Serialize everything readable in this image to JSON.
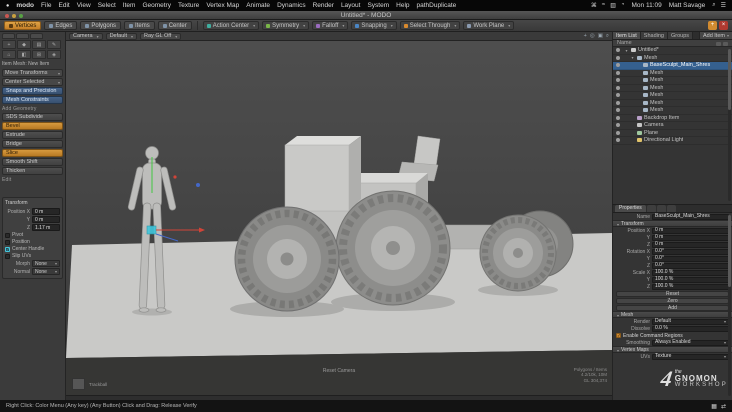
{
  "titlebar": {
    "title": "Untitled* - MODO"
  },
  "menu_bar": {
    "apple_icon": "●",
    "items": [
      "modo",
      "File",
      "Edit",
      "View",
      "Select",
      "Item",
      "Geometry",
      "Texture",
      "Vertex Map",
      "Animate",
      "Dynamics",
      "Render",
      "Layout",
      "System",
      "Help",
      "pathDuplicate"
    ],
    "status_icons": [
      "⌘",
      "≈",
      "▥",
      "◔"
    ],
    "clock": "Mon 11:09",
    "user": "Matt Savage",
    "spotlight_icon": "⌕",
    "notification_icon": "☰"
  },
  "toolbar": {
    "modes": [
      {
        "label": "Vertices",
        "active": true
      },
      {
        "label": "Edges"
      },
      {
        "label": "Polygons"
      },
      {
        "label": "Items"
      },
      {
        "label": "Center"
      }
    ],
    "tools": [
      {
        "label": "Action Center",
        "color": "#3fae9f"
      },
      {
        "label": "Symmetry",
        "color": "#7ab648"
      },
      {
        "label": "Falloff",
        "color": "#9a6bbf"
      },
      {
        "label": "Snapping",
        "color": "#4a86c5"
      },
      {
        "label": "Select Through",
        "color": "#d98a2e"
      },
      {
        "label": "Work Plane",
        "color": "#8a9ab0"
      }
    ],
    "add_button": "+",
    "close_button": "×"
  },
  "sidebar": {
    "palette_icons": [
      "+",
      "◆",
      "▤",
      "✎",
      "⌂",
      "◧",
      "⊞",
      "◈"
    ],
    "caption": "Item Mesh: New Item",
    "dropdowns": [
      {
        "label": "Move Transforms"
      },
      {
        "label": "Center Selected"
      }
    ],
    "palette_buttons": [
      {
        "label": "Snaps and Precision"
      },
      {
        "label": "Mesh Constraints"
      }
    ],
    "add_geometry_label": "Add Geometry",
    "tools": [
      {
        "label": "SDS Subdivide"
      },
      {
        "label": "Bevel",
        "accent": true
      },
      {
        "label": "Extrude"
      },
      {
        "label": "Bridge"
      },
      {
        "label": "Slice",
        "accent": true
      },
      {
        "label": "Smooth Shift"
      },
      {
        "label": "Thicken"
      }
    ],
    "edit_label": "Edit",
    "transform_panel": {
      "title": "Transform",
      "fields": [
        {
          "label": "Position X",
          "value": "0 m"
        },
        {
          "label": "Y",
          "value": "0 m"
        },
        {
          "label": "Z",
          "value": "1.17 m"
        }
      ],
      "toggles": [
        {
          "label": "Pivot",
          "checked": false
        },
        {
          "label": "Position",
          "checked": false
        },
        {
          "label": "Center Handle",
          "checked": true
        },
        {
          "label": "Slip UVs",
          "checked": false
        }
      ],
      "selects": [
        {
          "label": "Morph",
          "value": "None"
        },
        {
          "label": "Normal",
          "value": "None"
        }
      ]
    }
  },
  "viewport": {
    "header": {
      "camera_menu": "Camera",
      "view_menu": "Default",
      "raygl_menu": "Ray GL Off",
      "icons": [
        "+",
        "◎",
        "▣",
        "⌕"
      ]
    },
    "overlay": {
      "reset_camera": "Reset Camera",
      "trackball": "Trackball",
      "stats": [
        "Polygons / Items",
        "4.2/10k, 10M",
        "GL 304,374"
      ]
    }
  },
  "item_list": {
    "tabs": [
      {
        "label": "Item List"
      },
      {
        "label": "Shading"
      },
      {
        "label": "Groups"
      }
    ],
    "add_item_button": "Add Item",
    "name_column": "Name",
    "rows": [
      {
        "name": "Untitled*"
      },
      {
        "name": "Mesh"
      },
      {
        "name": "BaseSculpt_Main_Shres",
        "selected": true
      },
      {
        "name": "Mesh"
      },
      {
        "name": "Mesh"
      },
      {
        "name": "Mesh"
      },
      {
        "name": "Mesh"
      },
      {
        "name": "Mesh"
      },
      {
        "name": "Mesh"
      },
      {
        "name": "Backdrop Item"
      },
      {
        "name": "Camera"
      },
      {
        "name": "Plane"
      },
      {
        "name": "Directional Light"
      }
    ]
  },
  "properties": {
    "tab_label": "Properties",
    "name_label": "Name",
    "name_value": "BaseSculpt_Main_Shres",
    "transform_section": "Transform",
    "transform_rows": [
      {
        "label": "Position X",
        "value": "0 m"
      },
      {
        "label": "Y",
        "value": "0 m"
      },
      {
        "label": "Z",
        "value": "0 m"
      },
      {
        "label": "Rotation X",
        "value": "0.0°"
      },
      {
        "label": "Y",
        "value": "0.0°"
      },
      {
        "label": "Z",
        "value": "0.0°"
      },
      {
        "label": "Scale X",
        "value": "100.0 %"
      },
      {
        "label": "Y",
        "value": "100.0 %"
      },
      {
        "label": "Z",
        "value": "100.0 %"
      }
    ],
    "transform_buttons": [
      "Reset",
      "Zero",
      "Add"
    ],
    "mesh_section": "Mesh",
    "mesh_rows": [
      {
        "label": "Render",
        "value": "Default"
      },
      {
        "label": "Dissolve",
        "value": "0.0 %"
      }
    ],
    "command_regions_label": "Enable Command Regions",
    "smoothing_label": "Smoothing",
    "smoothing_value": "Always Enabled",
    "vertex_maps_section": "Vertex Maps",
    "uv_label": "UVs",
    "uv_value": "Texture"
  },
  "status_bar": {
    "help_text": "Right Click: Color Menu      (Any key) (Any Button) Click and Drag: Release Verify",
    "icons": [
      "▦",
      "⇄"
    ]
  },
  "watermark": {
    "prefix": "the",
    "name": "GNOMON",
    "suffix": "WORKSHOP",
    "mark": "4"
  },
  "colors": {
    "accent_orange": "#d08a30",
    "selection_blue": "#35608f",
    "check_teal": "#43c7dc"
  }
}
